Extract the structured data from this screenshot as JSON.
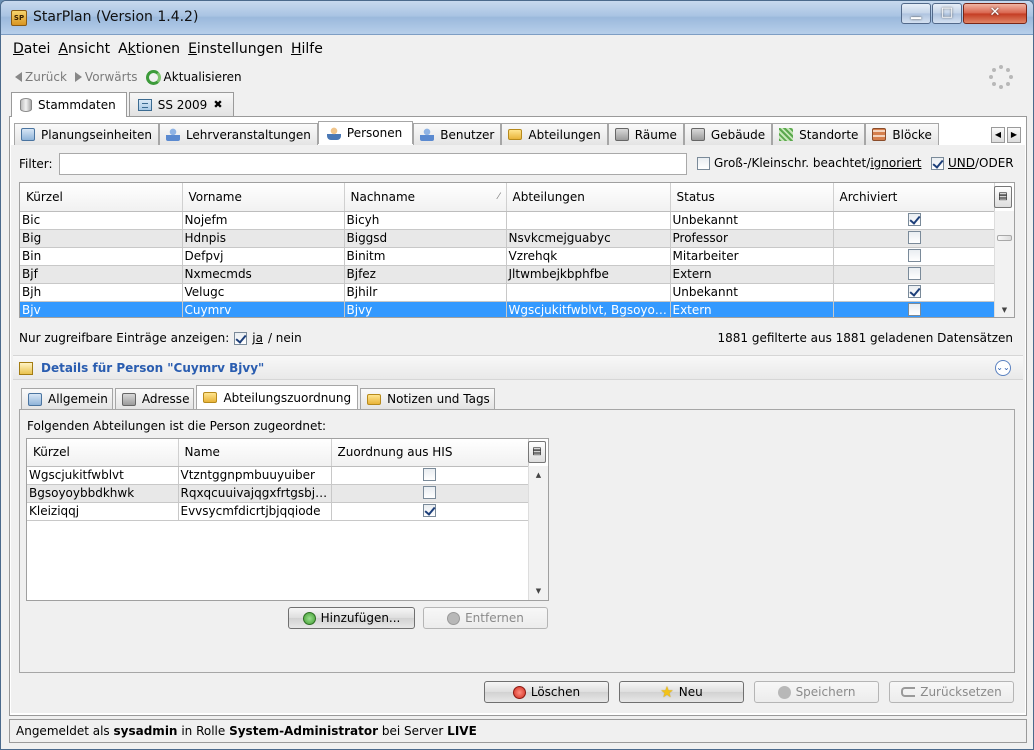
{
  "window": {
    "title": "StarPlan (Version 1.4.2)",
    "app_icon_label": "SP"
  },
  "menu": [
    {
      "label": "Datei",
      "mnemonic": "D",
      "rest": "atei"
    },
    {
      "label": "Ansicht",
      "mnemonic": "A",
      "rest": "nsicht"
    },
    {
      "label": "Aktionen",
      "pre": "A",
      "mnemonic": "k",
      "rest": "tionen"
    },
    {
      "label": "Einstellungen",
      "mnemonic": "E",
      "rest": "instellungen"
    },
    {
      "label": "Hilfe",
      "mnemonic": "H",
      "rest": "ilfe"
    }
  ],
  "toolbar": {
    "back": "Zurück",
    "forward": "Vorwärts",
    "refresh": "Aktualisieren"
  },
  "top_tabs": [
    {
      "label": "Stammdaten",
      "active": true
    },
    {
      "label": "SS 2009",
      "active": false,
      "closable": true
    }
  ],
  "sec_tabs": [
    {
      "label": "Planungseinheiten",
      "icon": "table-icon"
    },
    {
      "label": "Lehrveranstaltungen",
      "icon": "course-icon"
    },
    {
      "label": "Personen",
      "icon": "person-icon",
      "active": true
    },
    {
      "label": "Benutzer",
      "icon": "user-icon"
    },
    {
      "label": "Abteilungen",
      "icon": "folder-icon"
    },
    {
      "label": "Räume",
      "icon": "room-icon"
    },
    {
      "label": "Gebäude",
      "icon": "building-icon"
    },
    {
      "label": "Standorte",
      "icon": "location-icon"
    },
    {
      "label": "Blöcke",
      "icon": "blocks-icon"
    }
  ],
  "filter": {
    "label": "Filter:",
    "value": "",
    "case_label_pre": "Groß-/Kleinschr. beachtet/",
    "case_label_ignored": "ignoriert",
    "case_checked": false,
    "und_label": "UND",
    "oder_label": "/ODER",
    "und_checked": true
  },
  "persons": {
    "columns": [
      "Kürzel",
      "Vorname",
      "Nachname",
      "Abteilungen",
      "Status",
      "Archiviert"
    ],
    "sort_indicator": "⁄",
    "rows": [
      {
        "kuerzel": "Bic",
        "vorname": "Nojefm",
        "nachname": "Bicyh",
        "abteilungen": "",
        "status": "Unbekannt",
        "archived": true
      },
      {
        "kuerzel": "Big",
        "vorname": "Hdnpis",
        "nachname": "Biggsd",
        "abteilungen": "Nsvkcmejguabyc",
        "status": "Professor",
        "archived": false
      },
      {
        "kuerzel": "Bin",
        "vorname": "Defpvj",
        "nachname": "Binitm",
        "abteilungen": "Vzrehqk",
        "status": "Mitarbeiter",
        "archived": false
      },
      {
        "kuerzel": "Bjf",
        "vorname": "Nxmecmds",
        "nachname": "Bjfez",
        "abteilungen": "Jltwmbejkbphfbe",
        "status": "Extern",
        "archived": false
      },
      {
        "kuerzel": "Bjh",
        "vorname": "Velugc",
        "nachname": "Bjhilr",
        "abteilungen": "",
        "status": "Unbekannt",
        "archived": true
      },
      {
        "kuerzel": "Bjv",
        "vorname": "Cuymrv",
        "nachname": "Bjvy",
        "abteilungen": "Wgscjukitfwblvt, Bgsoyoy...",
        "status": "Extern",
        "archived": false,
        "selected": true
      }
    ]
  },
  "only_accessible": {
    "label": "Nur zugreifbare Einträge anzeigen:",
    "ja": "ja",
    "nein": "/ nein",
    "checked": true
  },
  "count_text": "1881 gefilterte aus 1881 geladenen Datensätzen",
  "details": {
    "title": "Details für Person \"Cuymrv Bjvy\""
  },
  "detail_tabs": [
    {
      "label": "Allgemein",
      "icon": "general-icon"
    },
    {
      "label": "Adresse",
      "icon": "home-icon"
    },
    {
      "label": "Abteilungszuordnung",
      "icon": "folder-icon",
      "active": true
    },
    {
      "label": "Notizen und Tags",
      "icon": "notes-icon"
    }
  ],
  "assignment": {
    "label": "Folgenden Abteilungen ist die Person zugeordnet:",
    "columns": [
      "Kürzel",
      "Name",
      "Zuordnung aus HIS"
    ],
    "rows": [
      {
        "kuerzel": "Wgscjukitfwblvt",
        "name": "Vtzntggnpmbuuyuiber",
        "his": false
      },
      {
        "kuerzel": "Bgsoyoybbdkhwk",
        "name": "Rqxqcuuivajqgxfrtgsbjo...",
        "his": false
      },
      {
        "kuerzel": "Kleiziqqj",
        "name": "Evvsycmfdicrtjbjqqiode",
        "his": true
      }
    ],
    "add_button": "Hinzufügen...",
    "remove_button": "Entfernen"
  },
  "actions": {
    "delete": "Löschen",
    "new": "Neu",
    "save": "Speichern",
    "reset": "Zurücksetzen"
  },
  "status": {
    "pre": "Angemeldet als",
    "user": "sysadmin",
    "mid": "in Rolle",
    "role": "System-Administrator",
    "mid2": "bei Server",
    "server": "LIVE"
  },
  "colors": {
    "selection": "#3399ff",
    "details_title": "#2a5db0"
  }
}
